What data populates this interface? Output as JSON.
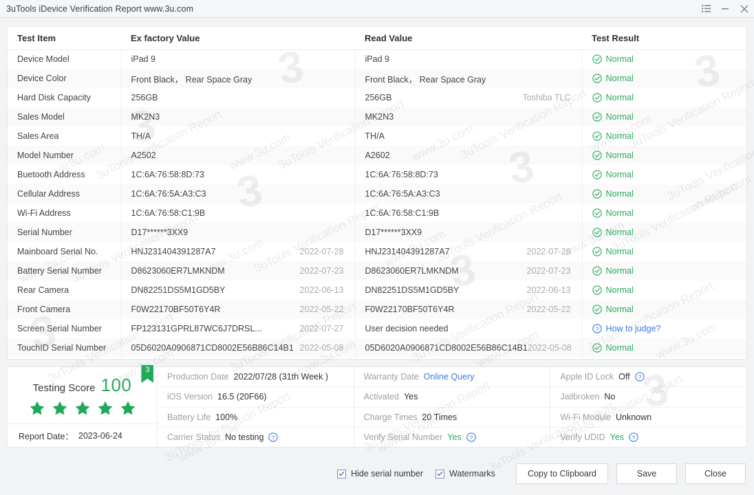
{
  "window": {
    "title": "3uTools iDevice Verification Report www.3u.com",
    "buttons": [
      {
        "name": "list-icon",
        "label": ""
      },
      {
        "name": "minimize-icon",
        "label": ""
      },
      {
        "name": "close-icon",
        "label": ""
      }
    ]
  },
  "colors": {
    "normal_green": "#2aab5c",
    "link_blue": "#3b7ddd",
    "muted_gray": "#a8acb1"
  },
  "table": {
    "headers": [
      "Test Item",
      "Ex factory Value",
      "Read Value",
      "Test Result"
    ],
    "rows": [
      {
        "item": "Device Model",
        "ex": "iPad 9",
        "ex_sub": "",
        "read": "iPad 9",
        "read_sub": "",
        "result": "Normal",
        "result_type": "normal"
      },
      {
        "item": "Device Color",
        "ex": "Front Black， Rear Space Gray",
        "ex_sub": "",
        "read": "Front Black， Rear Space Gray",
        "read_sub": "",
        "result": "Normal",
        "result_type": "normal"
      },
      {
        "item": "Hard Disk Capacity",
        "ex": "256GB",
        "ex_sub": "",
        "read": "256GB",
        "read_sub": "Toshiba TLC",
        "result": "Normal",
        "result_type": "normal"
      },
      {
        "item": "Sales Model",
        "ex": "MK2N3",
        "ex_sub": "",
        "read": "MK2N3",
        "read_sub": "",
        "result": "Normal",
        "result_type": "normal"
      },
      {
        "item": "Sales Area",
        "ex": "TH/A",
        "ex_sub": "",
        "read": "TH/A",
        "read_sub": "",
        "result": "Normal",
        "result_type": "normal"
      },
      {
        "item": "Model Number",
        "ex": "A2502",
        "ex_sub": "",
        "read": "A2602",
        "read_sub": "",
        "result": "Normal",
        "result_type": "normal"
      },
      {
        "item": "Buetooth Address",
        "ex": "1C:6A:76:58:8D:73",
        "ex_sub": "",
        "read": "1C:6A:76:58:8D:73",
        "read_sub": "",
        "result": "Normal",
        "result_type": "normal"
      },
      {
        "item": "Cellular Address",
        "ex": "1C:6A:76:5A:A3:C3",
        "ex_sub": "",
        "read": "1C:6A:76:5A:A3:C3",
        "read_sub": "",
        "result": "Normal",
        "result_type": "normal"
      },
      {
        "item": "Wi-Fi Address",
        "ex": "1C:6A:76:58:C1:9B",
        "ex_sub": "",
        "read": "1C:6A:76:58:C1:9B",
        "read_sub": "",
        "result": "Normal",
        "result_type": "normal"
      },
      {
        "item": "Serial Number",
        "ex": "D17******3XX9",
        "ex_sub": "",
        "read": "D17******3XX9",
        "read_sub": "",
        "result": "Normal",
        "result_type": "normal"
      },
      {
        "item": "Mainboard Serial No.",
        "ex": "HNJ231404391287A7",
        "ex_sub": "2022-07-28",
        "read": "HNJ231404391287A7",
        "read_sub": "2022-07-28",
        "result": "Normal",
        "result_type": "normal"
      },
      {
        "item": "Battery Serial Number",
        "ex": "D8623060ER7LMKNDM",
        "ex_sub": "2022-07-23",
        "read": "D8623060ER7LMKNDM",
        "read_sub": "2022-07-23",
        "result": "Normal",
        "result_type": "normal"
      },
      {
        "item": "Rear Camera",
        "ex": "DN82251DS5M1GD5BY",
        "ex_sub": "2022-06-13",
        "read": "DN82251DS5M1GD5BY",
        "read_sub": "2022-06-13",
        "result": "Normal",
        "result_type": "normal"
      },
      {
        "item": "Front Camera",
        "ex": "F0W22170BF50T6Y4R",
        "ex_sub": "2022-05-22",
        "read": "F0W22170BF50T6Y4R",
        "read_sub": "2022-05-22",
        "result": "Normal",
        "result_type": "normal"
      },
      {
        "item": "Screen Serial Number",
        "ex": "FP123131GPRL87WC6J7DRSL...",
        "ex_sub": "2022-07-27",
        "read": "User decision needed",
        "read_sub": "",
        "result": "How to judge?",
        "result_type": "question"
      },
      {
        "item": "TouchID Serial Number",
        "ex": "05D6020A0906871CD8002E56B86C14B1",
        "ex_sub": "2022-05-08",
        "read": "05D6020A0906871CD8002E56B86C14B1",
        "read_sub": "2022-05-08",
        "result": "Normal",
        "result_type": "normal"
      }
    ]
  },
  "summary": {
    "score_label": "Testing Score",
    "score_value": "100",
    "ribbon_badge": "3",
    "stars": 5,
    "report_date_label": "Report Date：",
    "report_date_value": "2023-06-24",
    "panes": [
      {
        "rows": [
          {
            "label": "Production Date",
            "value": "2022/07/28 (31th Week )",
            "style": "plain",
            "help": false
          },
          {
            "label": "iOS Version",
            "value": "16.5 (20F66)",
            "style": "plain",
            "help": false
          },
          {
            "label": "Battery Life",
            "value": "100%",
            "style": "plain",
            "help": false
          },
          {
            "label": "Carrier Status",
            "value": "No testing",
            "style": "plain",
            "help": true
          }
        ]
      },
      {
        "rows": [
          {
            "label": "Warranty Date",
            "value": "Online Query",
            "style": "link",
            "help": false
          },
          {
            "label": "Activated",
            "value": "Yes",
            "style": "plain",
            "help": false
          },
          {
            "label": "Charge Times",
            "value": "20 Times",
            "style": "plain",
            "help": false
          },
          {
            "label": "Verify Serial Number",
            "value": "Yes",
            "style": "green",
            "help": true
          }
        ]
      },
      {
        "rows": [
          {
            "label": "Apple ID Lock",
            "value": "Off",
            "style": "plain",
            "help": true
          },
          {
            "label": "Jailbroken",
            "value": "No",
            "style": "plain",
            "help": false
          },
          {
            "label": "Wi-Fi Module",
            "value": "Unknown",
            "style": "plain",
            "help": false
          },
          {
            "label": "Verify UDID",
            "value": "Yes",
            "style": "green",
            "help": true
          }
        ]
      }
    ]
  },
  "footer": {
    "checkboxes": [
      {
        "label": "Hide serial number",
        "checked": true
      },
      {
        "label": "Watermarks",
        "checked": true
      }
    ],
    "buttons": [
      {
        "label": "Copy to Clipboard"
      },
      {
        "label": "Save"
      },
      {
        "label": "Close"
      }
    ]
  },
  "watermark": {
    "text": "3uTools Verification Report",
    "url": "www.3u.com",
    "logo": "3"
  }
}
